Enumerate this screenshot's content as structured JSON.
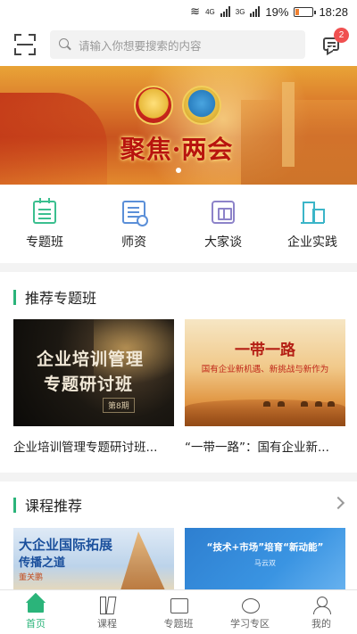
{
  "status_bar": {
    "network_1": "4G",
    "network_2": "3G",
    "battery_percent": "19%",
    "time": "18:28"
  },
  "header": {
    "search_placeholder": "请输入你想要搜索的内容",
    "message_badge": "2"
  },
  "banner": {
    "title": "聚焦·两会",
    "slide_count": 1,
    "active_slide": 0
  },
  "categories": [
    {
      "label": "专题班",
      "icon": "calendar-icon",
      "color": "#3bbf8f"
    },
    {
      "label": "师资",
      "icon": "document-icon",
      "color": "#5b8fd8"
    },
    {
      "label": "大家谈",
      "icon": "book-icon",
      "color": "#8d83c9"
    },
    {
      "label": "企业实践",
      "icon": "building-icon",
      "color": "#3bb5c8"
    }
  ],
  "featured": {
    "title": "推荐专题班",
    "cards": [
      {
        "thumb_line1": "企业培训管理",
        "thumb_line2": "专题研讨班",
        "thumb_tag": "第8期",
        "title": "企业培训管理专题研讨班..."
      },
      {
        "thumb_line1": "一带一路",
        "thumb_line2": "国有企业新机遇、新挑战与新作为",
        "title": "“一带一路”：国有企业新..."
      }
    ]
  },
  "recommend": {
    "title": "课程推荐",
    "cards": [
      {
        "line1": "大企业国际拓展",
        "line2": "传播之道",
        "line3": "董关鹏"
      },
      {
        "line1": "“技术+市场”培育“新动能”",
        "line2": "马云双"
      }
    ]
  },
  "bottom_nav": [
    {
      "label": "首页",
      "icon": "home-icon",
      "active": true
    },
    {
      "label": "课程",
      "icon": "course-icon",
      "active": false
    },
    {
      "label": "专题班",
      "icon": "topic-icon",
      "active": false
    },
    {
      "label": "学习专区",
      "icon": "zone-icon",
      "active": false
    },
    {
      "label": "我的",
      "icon": "profile-icon",
      "active": false
    }
  ],
  "colors": {
    "accent": "#2bb47a",
    "badge": "#f05050"
  }
}
